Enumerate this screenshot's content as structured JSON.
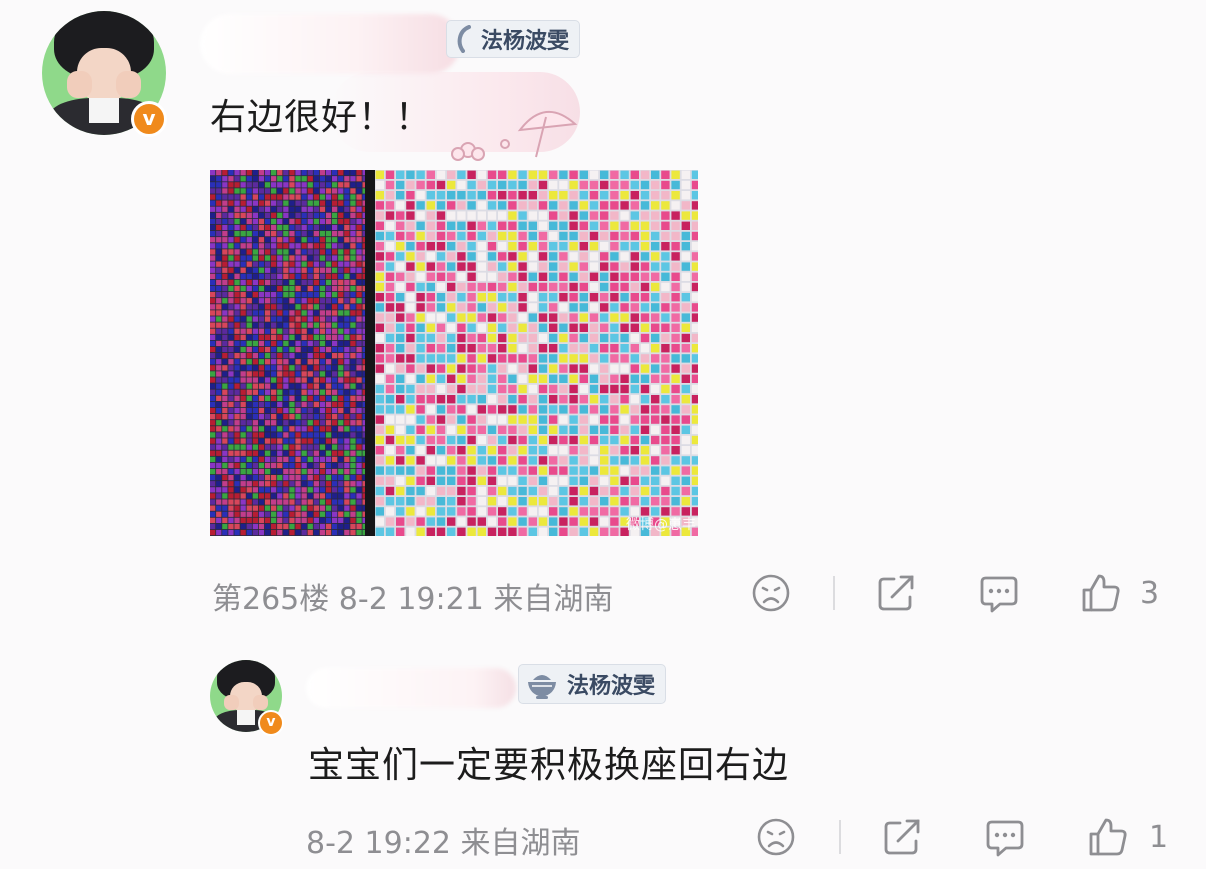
{
  "comments": [
    {
      "medal_label": "法杨波雯",
      "text": "右边很好！！",
      "image_watermark": "微博@崽丰",
      "meta": "第265楼 8-2 19:21 来自湖南",
      "like_count": "3"
    },
    {
      "medal_label": "法杨波雯",
      "text": "宝宝们一定要积极换座回右边",
      "meta": "8-2 19:22 来自湖南",
      "like_count": "1"
    }
  ],
  "colors": {
    "background": "#fbfafb",
    "meta_text": "#8e8e92",
    "verified_badge": "#f08a1c",
    "medal_text": "#3a4a63",
    "medal_bg": "#eef1f5"
  },
  "icons": {
    "verified": "v-badge-icon",
    "medal": "rice-bowl-icon",
    "dislike": "sad-face-icon",
    "share": "share-icon",
    "reply": "comment-bubble-icon",
    "like": "thumb-up-icon"
  },
  "image": {
    "left_panel_palette": [
      "#b71d33",
      "#2a2fb8",
      "#3aa542",
      "#8a35c4",
      "#c13d8b",
      "#5b2a9e",
      "#d7465b",
      "#1f1f8a"
    ],
    "right_panel_palette": [
      "#e84a8c",
      "#47b9d8",
      "#ece83c",
      "#f2b7c8",
      "#c8225f",
      "#5cc6e3",
      "#f5f1f2",
      "#f06aa3"
    ]
  }
}
